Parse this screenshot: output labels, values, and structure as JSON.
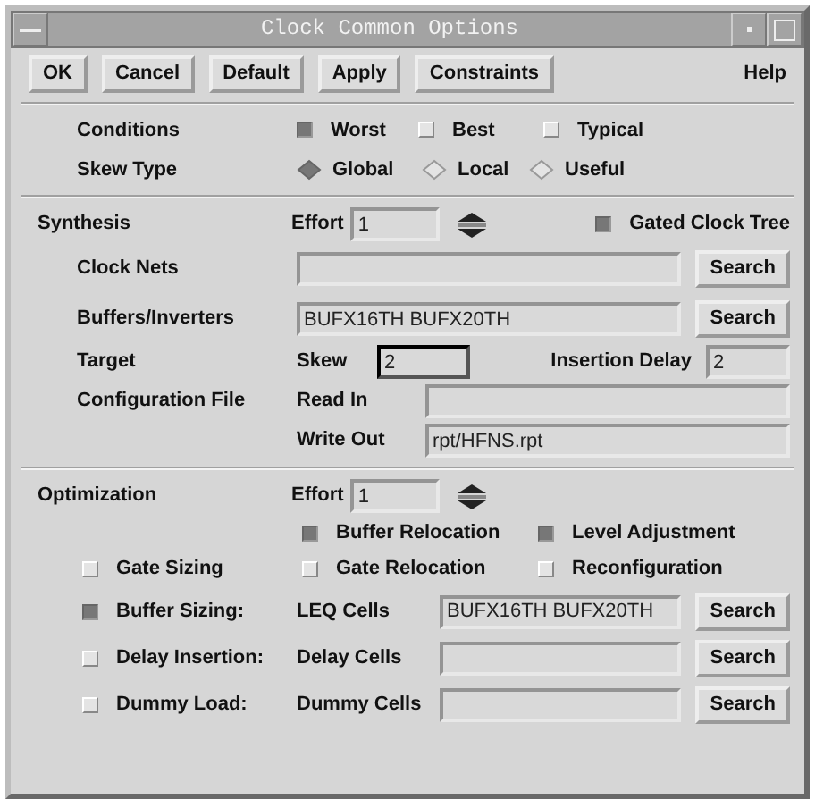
{
  "window": {
    "title": "Clock Common Options"
  },
  "toolbar": {
    "buttons": [
      "OK",
      "Cancel",
      "Default",
      "Apply",
      "Constraints"
    ],
    "help": "Help"
  },
  "conditions": {
    "label": "Conditions",
    "options": [
      {
        "label": "Worst",
        "selected": true
      },
      {
        "label": "Best",
        "selected": false
      },
      {
        "label": "Typical",
        "selected": false
      }
    ]
  },
  "skew_type": {
    "label": "Skew Type",
    "options": [
      {
        "label": "Global",
        "selected": true
      },
      {
        "label": "Local",
        "selected": false
      },
      {
        "label": "Useful",
        "selected": false
      }
    ]
  },
  "synthesis": {
    "title": "Synthesis",
    "effort_label": "Effort",
    "effort": "1",
    "gated_clock_tree": {
      "label": "Gated Clock Tree",
      "checked": true
    },
    "clock_nets": {
      "label": "Clock Nets",
      "button": "Search"
    },
    "buffers_inverters": {
      "label": "Buffers/Inverters",
      "value": "BUFX16TH BUFX20TH",
      "button": "Search"
    },
    "target": {
      "label": "Target",
      "skew_label": "Skew",
      "skew": "2",
      "insertion_delay_label": "Insertion Delay",
      "insertion_delay": "2"
    },
    "configuration_file": {
      "label": "Configuration File",
      "read_in_label": "Read In",
      "write_out_label": "Write Out",
      "write_out": "rpt/HFNS.rpt"
    }
  },
  "optimization": {
    "title": "Optimization",
    "effort_label": "Effort",
    "effort": "1",
    "options": [
      {
        "label": "Buffer Relocation",
        "checked": true
      },
      {
        "label": "Level Adjustment",
        "checked": true
      },
      {
        "label": "Gate Sizing",
        "checked": false
      },
      {
        "label": "Gate Relocation",
        "checked": false
      },
      {
        "label": "Reconfiguration",
        "checked": false
      }
    ],
    "cells": [
      {
        "label": "Buffer Sizing:",
        "checked": true,
        "field_label": "LEQ Cells",
        "value": "BUFX16TH BUFX20TH",
        "button": "Search"
      },
      {
        "label": "Delay Insertion:",
        "checked": false,
        "field_label": "Delay Cells",
        "button": "Search"
      },
      {
        "label": "Dummy Load:",
        "checked": false,
        "field_label": "Dummy Cells",
        "button": "Search"
      }
    ]
  }
}
